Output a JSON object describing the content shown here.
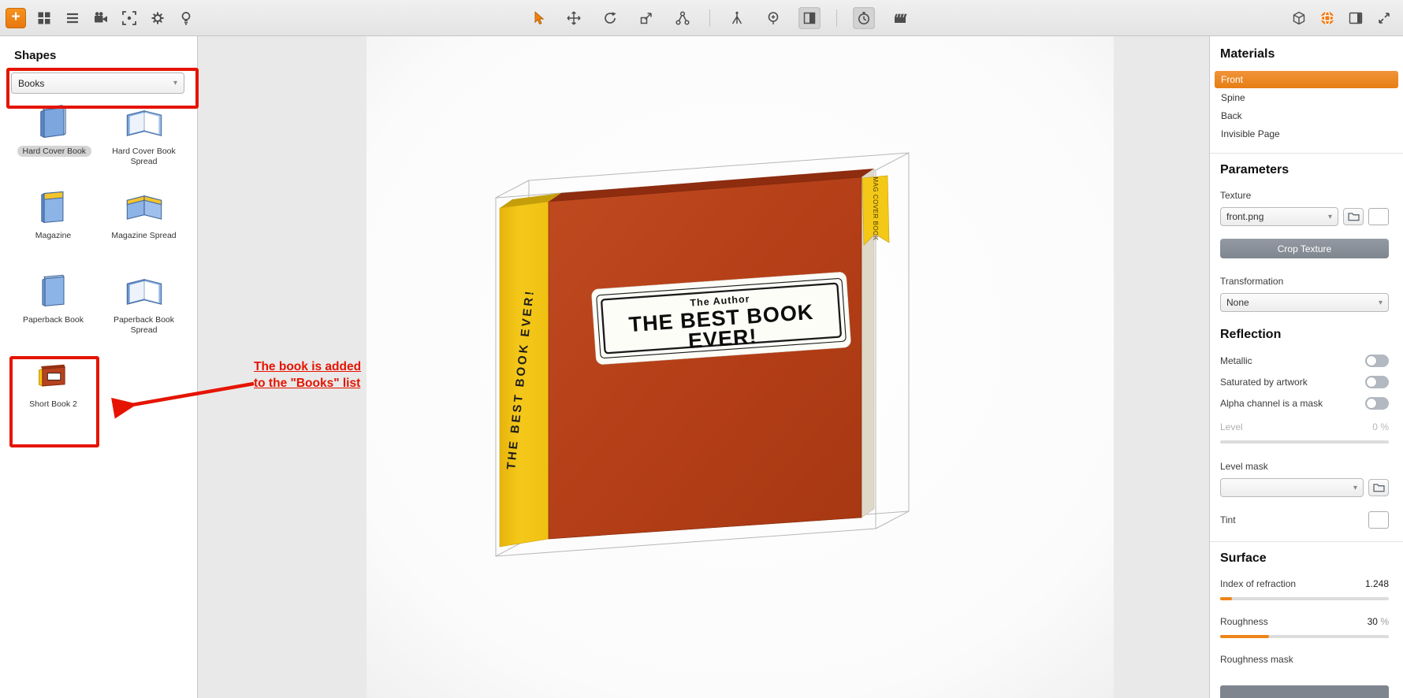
{
  "app": {
    "accent_orange": "#ee8418",
    "annotation_red": "#e51400"
  },
  "toolbar": {
    "left_icons": [
      "add-shape",
      "grid-view",
      "list-view",
      "video-camera",
      "viewfinder",
      "settings-gear",
      "lamp"
    ],
    "center_icons": [
      "select-tool",
      "move-tool",
      "rotate-tool",
      "scale-tool",
      "hierarchy-tool",
      "plumb-tool",
      "balloon-tool",
      "contrast-tool",
      "timer",
      "clapperboard"
    ],
    "right_icons": [
      "cube",
      "material-sphere",
      "panel-layout",
      "fullscreen"
    ]
  },
  "shapes_panel": {
    "title": "Shapes",
    "category_dropdown": "Books",
    "items": [
      {
        "label": "Hard Cover Book",
        "selected": true
      },
      {
        "label": "Hard Cover Book Spread"
      },
      {
        "label": "Magazine"
      },
      {
        "label": "Magazine Spread"
      },
      {
        "label": "Paperback Book"
      },
      {
        "label": "Paperback Book Spread"
      },
      {
        "label": "Short Book 2",
        "highlighted": true
      }
    ]
  },
  "annotation": {
    "line1": "The book is added",
    "line2": "to the \"Books\" list"
  },
  "canvas": {
    "book": {
      "author": "The Author",
      "title_line1": "THE BEST BOOK",
      "title_line2": "EVER!",
      "spine_text": "THE BEST BOOK EVER!",
      "bookmark_text": "MAG COVER BOOK",
      "cover_color": "#b5421c",
      "spine_color": "#f2c212"
    }
  },
  "materials_panel": {
    "title": "Materials",
    "layers": [
      {
        "label": "Front",
        "selected": true
      },
      {
        "label": "Spine"
      },
      {
        "label": "Back"
      },
      {
        "label": "Invisible Page"
      }
    ],
    "parameters": {
      "title": "Parameters",
      "texture_label": "Texture",
      "texture_value": "front.png",
      "crop_button": "Crop Texture",
      "transformation_label": "Transformation",
      "transformation_value": "None"
    },
    "reflection": {
      "title": "Reflection",
      "toggles": [
        "Metallic",
        "Saturated by artwork",
        "Alpha channel is a mask"
      ],
      "level_label": "Level",
      "level_value": "0",
      "level_unit": "%",
      "level_mask_label": "Level mask",
      "tint_label": "Tint"
    },
    "surface": {
      "title": "Surface",
      "ior_label": "Index of refraction",
      "ior_value": "1.248",
      "roughness_label": "Roughness",
      "roughness_value": "30",
      "roughness_unit": "%",
      "roughness_mask_label": "Roughness mask"
    }
  }
}
